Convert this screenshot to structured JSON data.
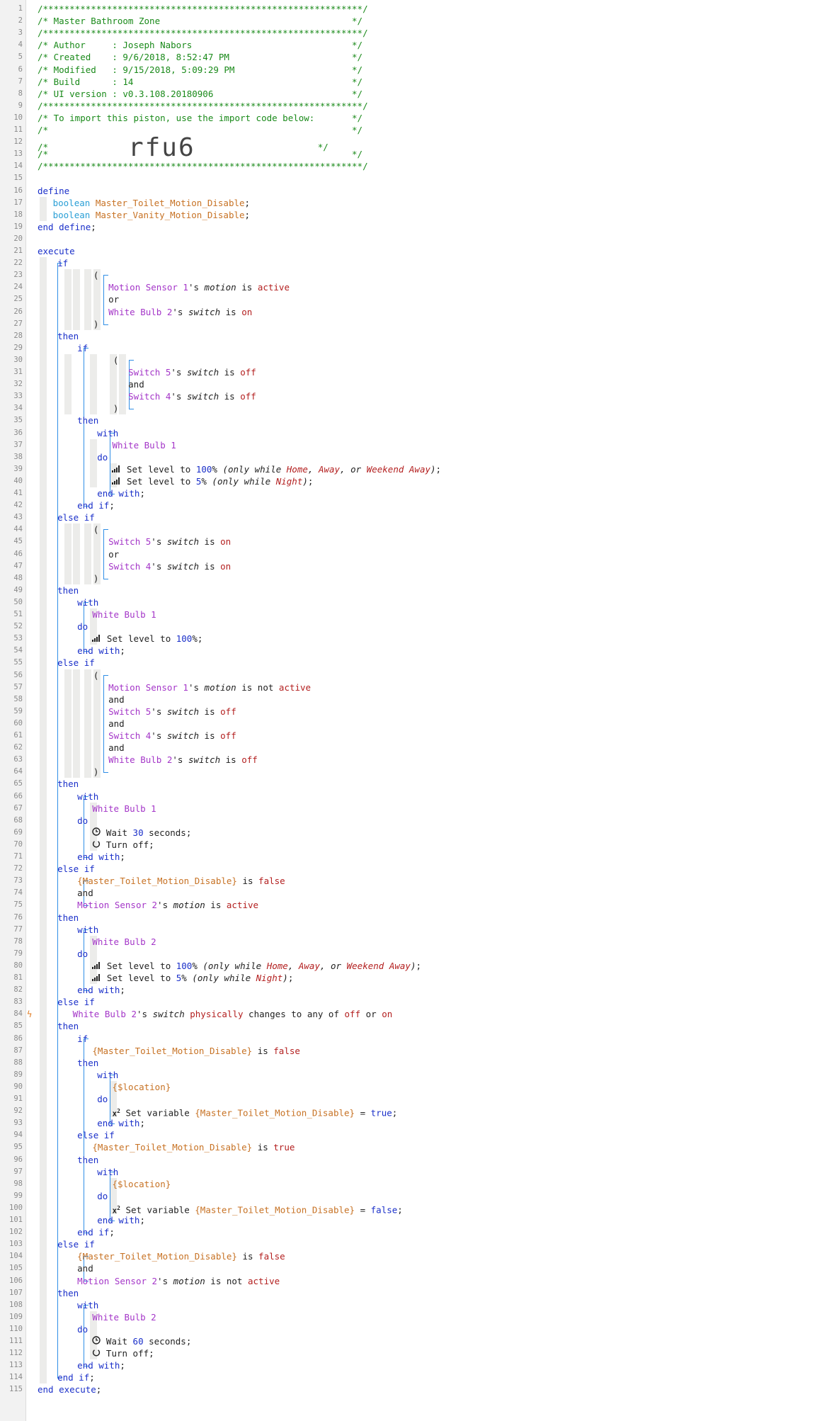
{
  "editor": {
    "title": "Master Bathroom Zone",
    "header": {
      "author": "Joseph Nabors",
      "created": "9/6/2018, 8:52:47 PM",
      "modified": "9/15/2018, 5:09:29 PM",
      "build": "14",
      "ui_version": "v0.3.108.20180906",
      "import_note": "To import this piston, use the import code below:",
      "import_code": "rfu6"
    },
    "variables": [
      "Master_Toilet_Motion_Disable",
      "Master_Vanity_Motion_Disable"
    ],
    "devices": [
      "Motion Sensor 1",
      "Motion Sensor 2",
      "White Bulb 1",
      "White Bulb 2",
      "Switch 4",
      "Switch 5"
    ],
    "modes": [
      "Home",
      "Away",
      "Weekend Away",
      "Night"
    ],
    "line_count": "115"
  },
  "colors": {
    "comment": "#1a8a1a",
    "keyword": "#1a2fc9",
    "device": "#a436c8",
    "variable": "#c77224",
    "value": "#b31f1f",
    "guide": "#2f8ee6"
  },
  "icons": [
    "level-icon",
    "clock-icon",
    "power-icon",
    "variable-icon",
    "trigger-bolt-icon"
  ]
}
